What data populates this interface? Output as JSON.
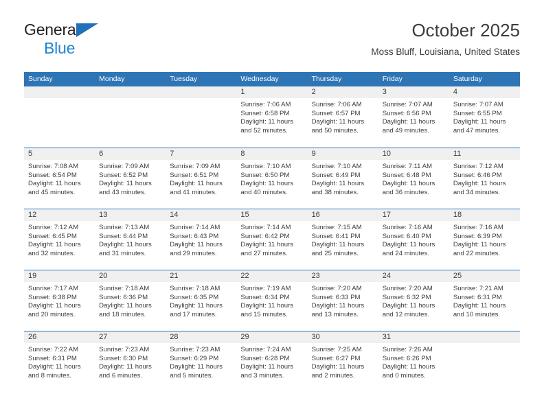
{
  "brand": {
    "name_top": "General",
    "name_bottom": "Blue",
    "triangle_color": "#1f71b8",
    "blue_color": "#1f84d0"
  },
  "header": {
    "title": "October 2025",
    "subtitle": "Moss Bluff, Louisiana, United States"
  },
  "theme": {
    "header_blue": "#2e75b6",
    "day_band_gray": "#f0f0f0",
    "text_color": "#3c3c3c"
  },
  "weekdays": [
    "Sunday",
    "Monday",
    "Tuesday",
    "Wednesday",
    "Thursday",
    "Friday",
    "Saturday"
  ],
  "weeks": [
    [
      {
        "day": "",
        "empty": true
      },
      {
        "day": "",
        "empty": true
      },
      {
        "day": "",
        "empty": true
      },
      {
        "day": "1",
        "sunrise": "Sunrise: 7:06 AM",
        "sunset": "Sunset: 6:58 PM",
        "daylight": "Daylight: 11 hours and 52 minutes."
      },
      {
        "day": "2",
        "sunrise": "Sunrise: 7:06 AM",
        "sunset": "Sunset: 6:57 PM",
        "daylight": "Daylight: 11 hours and 50 minutes."
      },
      {
        "day": "3",
        "sunrise": "Sunrise: 7:07 AM",
        "sunset": "Sunset: 6:56 PM",
        "daylight": "Daylight: 11 hours and 49 minutes."
      },
      {
        "day": "4",
        "sunrise": "Sunrise: 7:07 AM",
        "sunset": "Sunset: 6:55 PM",
        "daylight": "Daylight: 11 hours and 47 minutes."
      }
    ],
    [
      {
        "day": "5",
        "sunrise": "Sunrise: 7:08 AM",
        "sunset": "Sunset: 6:54 PM",
        "daylight": "Daylight: 11 hours and 45 minutes."
      },
      {
        "day": "6",
        "sunrise": "Sunrise: 7:09 AM",
        "sunset": "Sunset: 6:52 PM",
        "daylight": "Daylight: 11 hours and 43 minutes."
      },
      {
        "day": "7",
        "sunrise": "Sunrise: 7:09 AM",
        "sunset": "Sunset: 6:51 PM",
        "daylight": "Daylight: 11 hours and 41 minutes."
      },
      {
        "day": "8",
        "sunrise": "Sunrise: 7:10 AM",
        "sunset": "Sunset: 6:50 PM",
        "daylight": "Daylight: 11 hours and 40 minutes."
      },
      {
        "day": "9",
        "sunrise": "Sunrise: 7:10 AM",
        "sunset": "Sunset: 6:49 PM",
        "daylight": "Daylight: 11 hours and 38 minutes."
      },
      {
        "day": "10",
        "sunrise": "Sunrise: 7:11 AM",
        "sunset": "Sunset: 6:48 PM",
        "daylight": "Daylight: 11 hours and 36 minutes."
      },
      {
        "day": "11",
        "sunrise": "Sunrise: 7:12 AM",
        "sunset": "Sunset: 6:46 PM",
        "daylight": "Daylight: 11 hours and 34 minutes."
      }
    ],
    [
      {
        "day": "12",
        "sunrise": "Sunrise: 7:12 AM",
        "sunset": "Sunset: 6:45 PM",
        "daylight": "Daylight: 11 hours and 32 minutes."
      },
      {
        "day": "13",
        "sunrise": "Sunrise: 7:13 AM",
        "sunset": "Sunset: 6:44 PM",
        "daylight": "Daylight: 11 hours and 31 minutes."
      },
      {
        "day": "14",
        "sunrise": "Sunrise: 7:14 AM",
        "sunset": "Sunset: 6:43 PM",
        "daylight": "Daylight: 11 hours and 29 minutes."
      },
      {
        "day": "15",
        "sunrise": "Sunrise: 7:14 AM",
        "sunset": "Sunset: 6:42 PM",
        "daylight": "Daylight: 11 hours and 27 minutes."
      },
      {
        "day": "16",
        "sunrise": "Sunrise: 7:15 AM",
        "sunset": "Sunset: 6:41 PM",
        "daylight": "Daylight: 11 hours and 25 minutes."
      },
      {
        "day": "17",
        "sunrise": "Sunrise: 7:16 AM",
        "sunset": "Sunset: 6:40 PM",
        "daylight": "Daylight: 11 hours and 24 minutes."
      },
      {
        "day": "18",
        "sunrise": "Sunrise: 7:16 AM",
        "sunset": "Sunset: 6:39 PM",
        "daylight": "Daylight: 11 hours and 22 minutes."
      }
    ],
    [
      {
        "day": "19",
        "sunrise": "Sunrise: 7:17 AM",
        "sunset": "Sunset: 6:38 PM",
        "daylight": "Daylight: 11 hours and 20 minutes."
      },
      {
        "day": "20",
        "sunrise": "Sunrise: 7:18 AM",
        "sunset": "Sunset: 6:36 PM",
        "daylight": "Daylight: 11 hours and 18 minutes."
      },
      {
        "day": "21",
        "sunrise": "Sunrise: 7:18 AM",
        "sunset": "Sunset: 6:35 PM",
        "daylight": "Daylight: 11 hours and 17 minutes."
      },
      {
        "day": "22",
        "sunrise": "Sunrise: 7:19 AM",
        "sunset": "Sunset: 6:34 PM",
        "daylight": "Daylight: 11 hours and 15 minutes."
      },
      {
        "day": "23",
        "sunrise": "Sunrise: 7:20 AM",
        "sunset": "Sunset: 6:33 PM",
        "daylight": "Daylight: 11 hours and 13 minutes."
      },
      {
        "day": "24",
        "sunrise": "Sunrise: 7:20 AM",
        "sunset": "Sunset: 6:32 PM",
        "daylight": "Daylight: 11 hours and 12 minutes."
      },
      {
        "day": "25",
        "sunrise": "Sunrise: 7:21 AM",
        "sunset": "Sunset: 6:31 PM",
        "daylight": "Daylight: 11 hours and 10 minutes."
      }
    ],
    [
      {
        "day": "26",
        "sunrise": "Sunrise: 7:22 AM",
        "sunset": "Sunset: 6:31 PM",
        "daylight": "Daylight: 11 hours and 8 minutes."
      },
      {
        "day": "27",
        "sunrise": "Sunrise: 7:23 AM",
        "sunset": "Sunset: 6:30 PM",
        "daylight": "Daylight: 11 hours and 6 minutes."
      },
      {
        "day": "28",
        "sunrise": "Sunrise: 7:23 AM",
        "sunset": "Sunset: 6:29 PM",
        "daylight": "Daylight: 11 hours and 5 minutes."
      },
      {
        "day": "29",
        "sunrise": "Sunrise: 7:24 AM",
        "sunset": "Sunset: 6:28 PM",
        "daylight": "Daylight: 11 hours and 3 minutes."
      },
      {
        "day": "30",
        "sunrise": "Sunrise: 7:25 AM",
        "sunset": "Sunset: 6:27 PM",
        "daylight": "Daylight: 11 hours and 2 minutes."
      },
      {
        "day": "31",
        "sunrise": "Sunrise: 7:26 AM",
        "sunset": "Sunset: 6:26 PM",
        "daylight": "Daylight: 11 hours and 0 minutes."
      },
      {
        "day": "",
        "empty": true
      }
    ]
  ]
}
